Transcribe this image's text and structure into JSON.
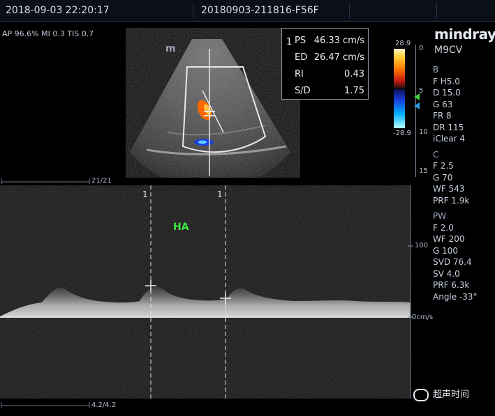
{
  "header": {
    "datetime": "2018-09-03 22:20:17",
    "study_id": "20180903-211816-F56F"
  },
  "acoustic_params": "AP 96.6%  MI 0.3  TIS 0.7",
  "measurements": {
    "index": "1",
    "rows": [
      {
        "label": "PS",
        "value": "46.33 cm/s"
      },
      {
        "label": "ED",
        "value": "26.47 cm/s"
      },
      {
        "label": "RI",
        "value": "0.43"
      },
      {
        "label": "S/D",
        "value": "1.75"
      }
    ]
  },
  "brand": "mindray",
  "probe": "M9CV",
  "logo_mark": "m",
  "color_scale": {
    "top": "28.9",
    "bottom": "-28.9"
  },
  "depth_ticks": [
    "0",
    "5",
    "10",
    "15"
  ],
  "side_panel": {
    "b_header": "B",
    "b_params": [
      "F H5.0",
      "D 15.0",
      "G 63",
      "FR 8",
      "DR 115",
      "iClear 4"
    ],
    "c_header": "C",
    "c_params": [
      "F 2.5",
      "G 70",
      "WF 543",
      "PRF 1.9k"
    ],
    "pw_header": "PW",
    "pw_params": [
      "F 2.0",
      "WF 200",
      "G 100",
      "SVD 76.4",
      "SV 4.0",
      "PRF 6.3k",
      "Angle -33°"
    ]
  },
  "upper_scale": "21/21",
  "lower_scale": "4.2/4.2",
  "vessel_label": "HA",
  "caliper_labels": [
    "1",
    "1"
  ],
  "velocity_scale": {
    "tick_100": "100",
    "baseline": "0cm/s"
  },
  "watermark": "超声时间",
  "colors": {
    "label_green": "#3fe63f",
    "trace": "#dcdcdc",
    "panel_bg": "#0b0f18"
  }
}
